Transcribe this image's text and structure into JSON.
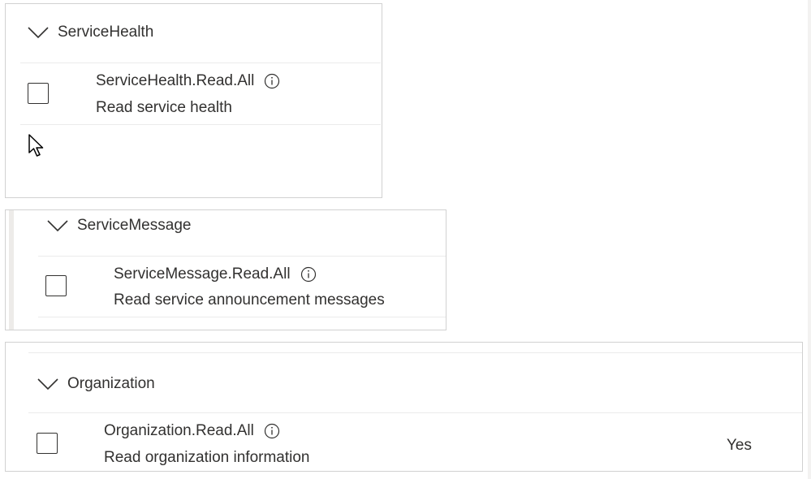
{
  "groups": [
    {
      "title": "ServiceHealth",
      "permission": {
        "name": "ServiceHealth.Read.All",
        "description": "Read service health",
        "admin_consent": ""
      }
    },
    {
      "title": "ServiceMessage",
      "permission": {
        "name": "ServiceMessage.Read.All",
        "description": "Read service announcement messages",
        "admin_consent": ""
      }
    },
    {
      "title": "Organization",
      "permission": {
        "name": "Organization.Read.All",
        "description": "Read organization information",
        "admin_consent": "Yes"
      }
    }
  ],
  "icons": {
    "expand": "chevron-down-icon",
    "info": "info-icon",
    "pointer": "mouse-cursor-icon"
  },
  "colors": {
    "text": "#323130",
    "border": "#d1d1d1",
    "divider": "#ebebeb",
    "accent_bar": "#edebe9"
  }
}
